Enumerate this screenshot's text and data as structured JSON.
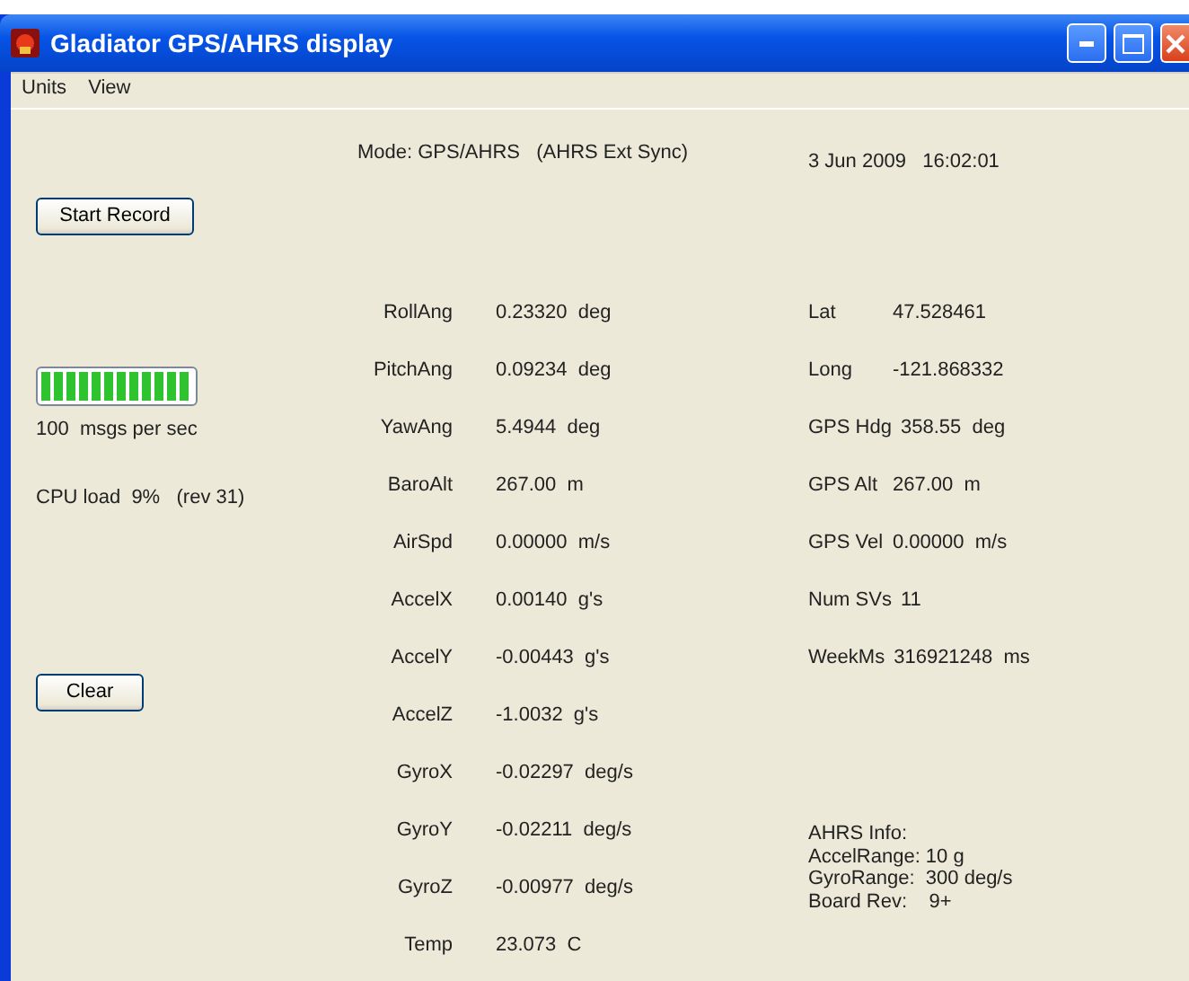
{
  "window": {
    "title": "Gladiator GPS/AHRS display"
  },
  "menu": [
    "Units",
    "View"
  ],
  "mode": "Mode: GPS/AHRS   (AHRS Ext Sync)",
  "datetime": "3 Jun 2009   16:02:01",
  "record_button": "Start Record",
  "message_rate": {
    "level": 1,
    "text": "100  msgs per sec"
  },
  "cpu": "CPU load  9%   (rev 31)",
  "clear_button": "Clear",
  "attitude": [
    {
      "label": "RollAng",
      "value": "0.23320  deg"
    },
    {
      "label": "PitchAng",
      "value": "0.09234  deg"
    },
    {
      "label": "YawAng",
      "value": "5.4944  deg"
    },
    {
      "label": "BaroAlt",
      "value": "267.00  m"
    },
    {
      "label": "AirSpd",
      "value": "0.00000  m/s"
    },
    {
      "label": "AccelX",
      "value": "0.00140  g's"
    },
    {
      "label": "AccelY",
      "value": "-0.00443  g's"
    },
    {
      "label": "AccelZ",
      "value": "-1.0032  g's"
    },
    {
      "label": "GyroX",
      "value": "-0.02297  deg/s"
    },
    {
      "label": "GyroY",
      "value": "-0.02211  deg/s"
    },
    {
      "label": "GyroZ",
      "value": "-0.00977  deg/s"
    },
    {
      "label": "Temp",
      "value": "23.073  C"
    }
  ],
  "gps": [
    {
      "label": "Lat",
      "value": "47.528461"
    },
    {
      "label": "Long",
      "value": "-121.868332"
    },
    {
      "label": "GPS Hdg",
      "value": "358.55  deg"
    },
    {
      "label": "GPS Alt",
      "value": "267.00  m"
    },
    {
      "label": "GPS Vel",
      "value": "0.00000  m/s"
    },
    {
      "label": "Num SVs",
      "value": "11"
    },
    {
      "label": "WeekMs",
      "value": "316921248  ms"
    }
  ],
  "ahrs_info": [
    "AHRS Info:",
    "AccelRange: 10 g",
    "GyroRange:  300 deg/s",
    "Board Rev:    9+"
  ]
}
